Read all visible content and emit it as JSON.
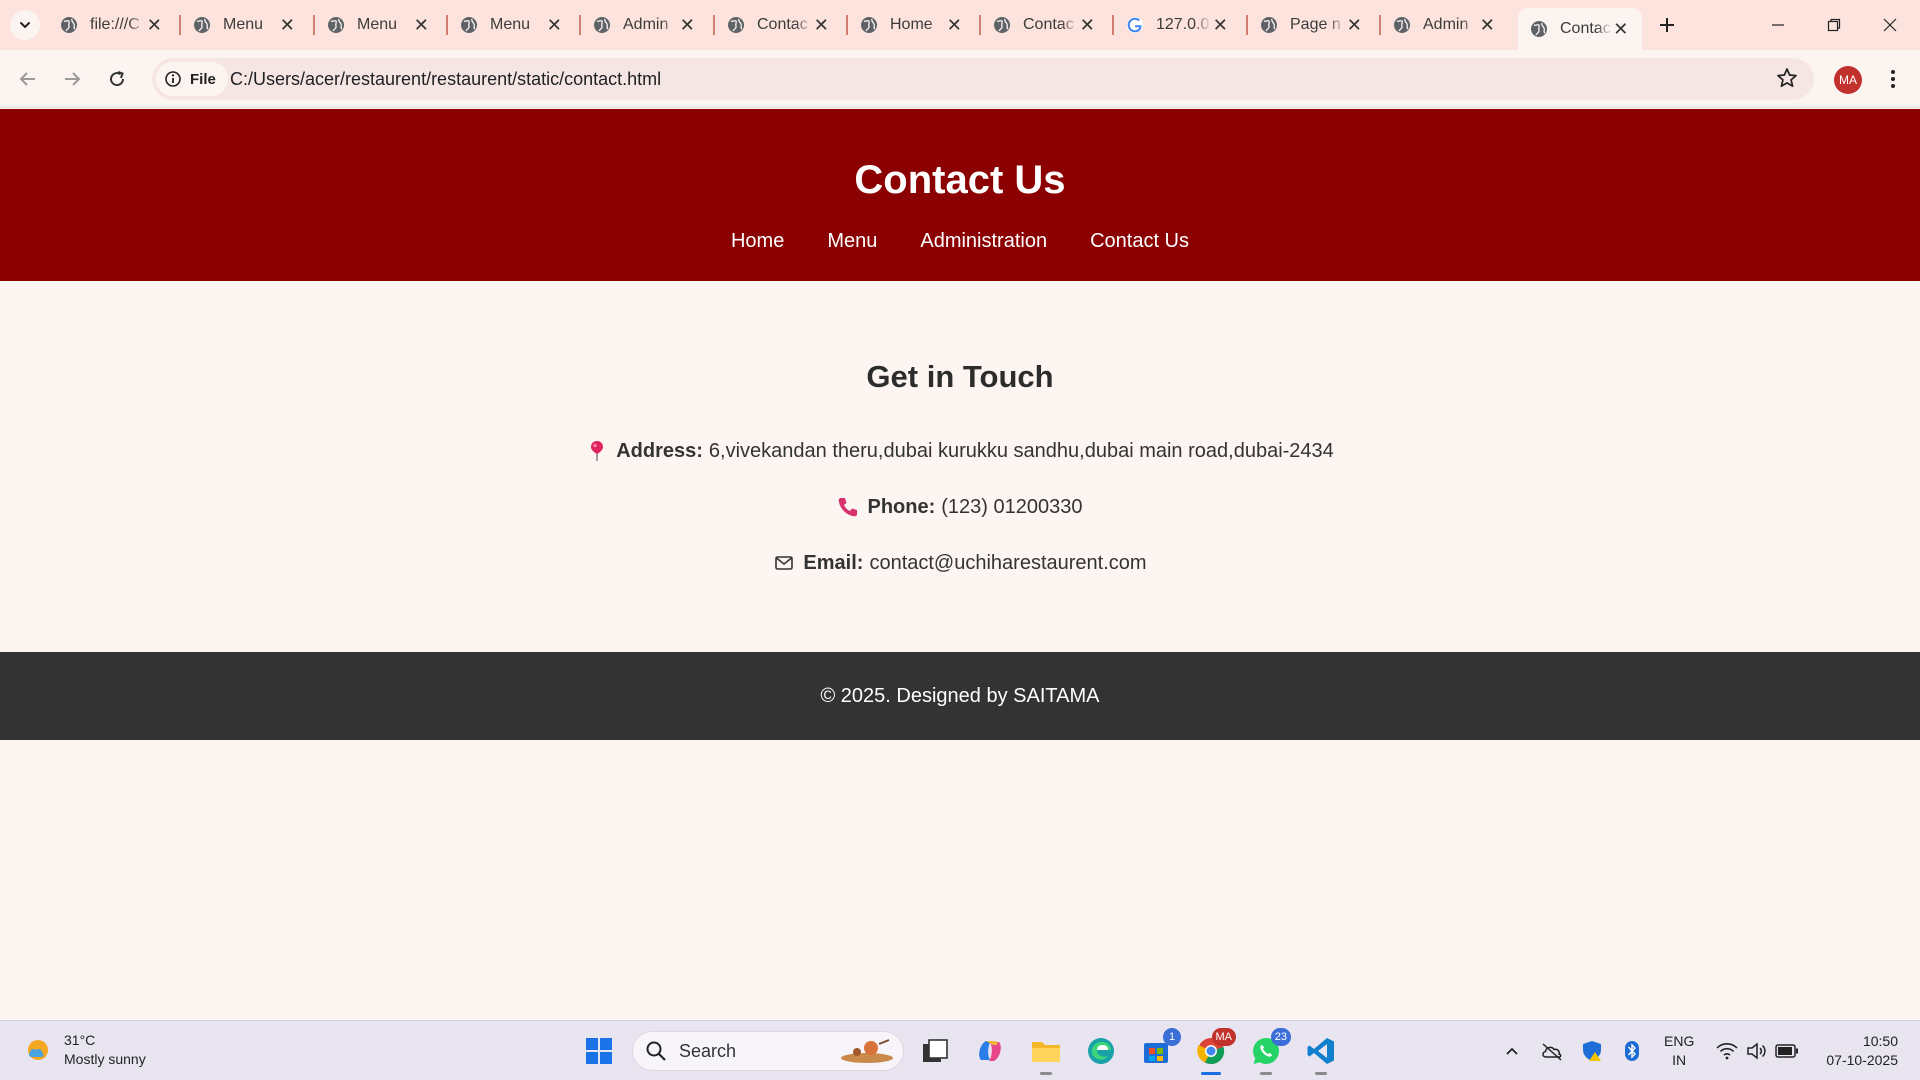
{
  "browser": {
    "tabs": [
      {
        "title": "file:///C",
        "active": false
      },
      {
        "title": "Menu",
        "active": false
      },
      {
        "title": "Menu",
        "active": false
      },
      {
        "title": "Menu",
        "active": false
      },
      {
        "title": "Admin",
        "active": false
      },
      {
        "title": "Contac",
        "active": false
      },
      {
        "title": "Home",
        "active": false
      },
      {
        "title": "Contac",
        "active": false
      },
      {
        "title": "127.0.0",
        "active": false
      },
      {
        "title": "Page n",
        "active": false
      },
      {
        "title": "Admin",
        "active": false
      },
      {
        "title": "Contac",
        "active": true
      }
    ],
    "site_chip": "File",
    "url": "C:/Users/acer/restaurent/restaurent/static/contact.html",
    "profile_initials": "MA"
  },
  "page": {
    "header": {
      "title": "Contact Us",
      "nav": [
        "Home",
        "Menu",
        "Administration",
        "Contact Us"
      ]
    },
    "contact": {
      "heading": "Get in Touch",
      "address_label": "Address:",
      "address_value": "6,vivekandan theru,dubai kurukku sandhu,dubai main road,dubai-2434",
      "phone_label": "Phone:",
      "phone_value": "(123) 01200330",
      "email_label": "Email:",
      "email_value": "contact@uchiharestaurent.com"
    },
    "footer": "© 2025. Designed by SAITAMA",
    "colors": {
      "header_bg": "#8b0000",
      "footer_bg": "#333333",
      "page_bg": "#fdf5f1"
    }
  },
  "taskbar": {
    "weather_temp": "31°C",
    "weather_desc": "Mostly sunny",
    "search_placeholder": "Search",
    "store_badge": "1",
    "chrome_badge": "MA",
    "whatsapp_badge": "23",
    "lang_top": "ENG",
    "lang_bottom": "IN",
    "time": "10:50",
    "date": "07-10-2025"
  }
}
